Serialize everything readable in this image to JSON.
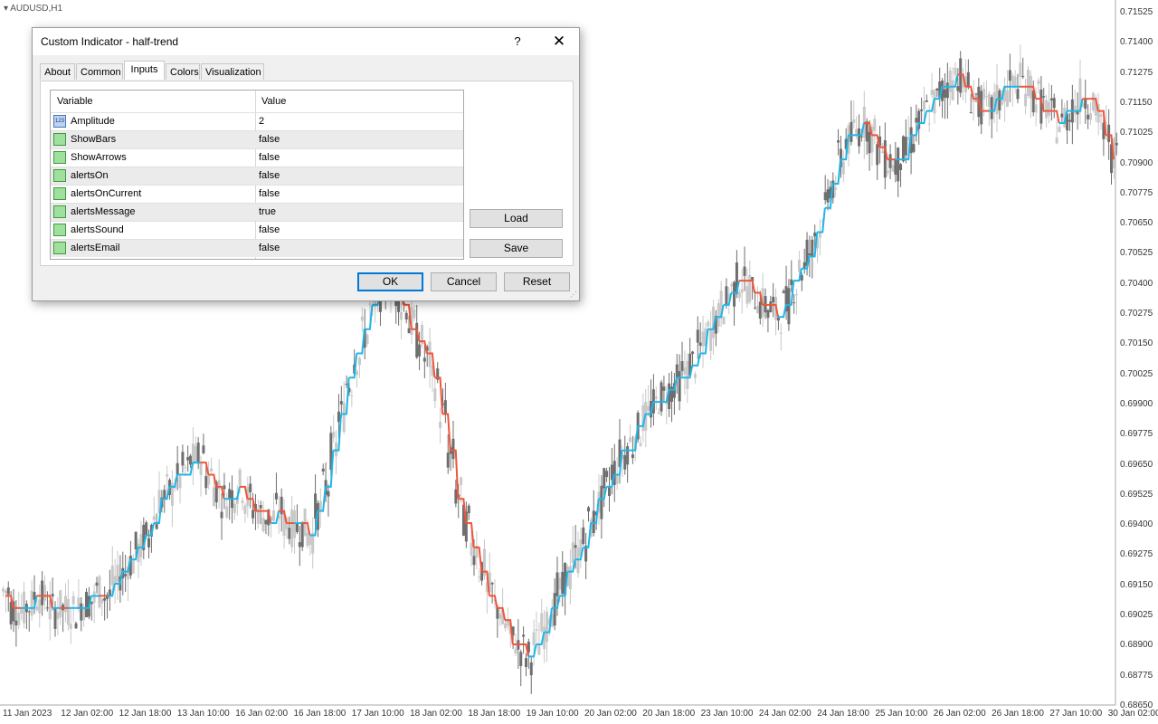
{
  "window": {
    "symbol": "AUDUSD,H1"
  },
  "y_axis": {
    "labels": [
      "0.71525",
      "0.71400",
      "0.71275",
      "0.71150",
      "0.71025",
      "0.70900",
      "0.70775",
      "0.70650",
      "0.70525",
      "0.70400",
      "0.70275",
      "0.70150",
      "0.70025",
      "0.69900",
      "0.69775",
      "0.69650",
      "0.69525",
      "0.69400",
      "0.69275",
      "0.69150",
      "0.69025",
      "0.68900",
      "0.68775",
      "0.68650"
    ]
  },
  "x_axis": {
    "labels": [
      "11 Jan 2023",
      "12 Jan 02:00",
      "12 Jan 18:00",
      "13 Jan 10:00",
      "16 Jan 02:00",
      "16 Jan 18:00",
      "17 Jan 10:00",
      "18 Jan 02:00",
      "18 Jan 18:00",
      "19 Jan 10:00",
      "20 Jan 02:00",
      "20 Jan 18:00",
      "23 Jan 10:00",
      "24 Jan 02:00",
      "24 Jan 18:00",
      "25 Jan 10:00",
      "26 Jan 02:00",
      "26 Jan 18:00",
      "27 Jan 10:00",
      "30 Jan 02:00"
    ]
  },
  "colors": {
    "trend_up": "#1fb6e8",
    "trend_down": "#f0553a",
    "candle_bull": "#c8c8c8",
    "candle_bear": "#6e6e6e",
    "accent": "#0078d7"
  },
  "chart_data": {
    "type": "line",
    "series": [
      {
        "values": [
          0.6912,
          0.6905,
          0.6904,
          0.6906,
          0.691,
          0.6909,
          0.6904,
          0.6905,
          0.6904,
          0.6904,
          0.6907,
          0.6908,
          0.6912,
          0.691,
          0.6915,
          0.6919,
          0.6924,
          0.6929,
          0.6934,
          0.6942,
          0.695,
          0.6953,
          0.6958,
          0.6962,
          0.6966,
          0.6967,
          0.696,
          0.6955,
          0.695,
          0.6952,
          0.6955,
          0.695,
          0.6946,
          0.6943,
          0.6942,
          0.6945,
          0.694,
          0.6938,
          0.6938,
          0.6935,
          0.6945,
          0.6955,
          0.697,
          0.6985,
          0.6998,
          0.7008,
          0.7018,
          0.7028,
          0.7035,
          0.704,
          0.7035,
          0.703,
          0.7022,
          0.7015,
          0.7008,
          0.6998,
          0.6985,
          0.6968,
          0.6952,
          0.694,
          0.693,
          0.6922,
          0.6912,
          0.6905,
          0.6898,
          0.6892,
          0.6888,
          0.6885,
          0.689,
          0.6896,
          0.6905,
          0.6912,
          0.6918,
          0.6926,
          0.6932,
          0.694,
          0.6948,
          0.6955,
          0.6962,
          0.6968,
          0.6972,
          0.6978,
          0.6983,
          0.6988,
          0.6992,
          0.6995,
          0.6998,
          0.7002,
          0.7006,
          0.7012,
          0.7018,
          0.7024,
          0.703,
          0.7036,
          0.704,
          0.7038,
          0.7034,
          0.703,
          0.7028,
          0.7026,
          0.703,
          0.7038,
          0.7045,
          0.7052,
          0.706,
          0.707,
          0.708,
          0.709,
          0.7098,
          0.7102,
          0.7105,
          0.71,
          0.7094,
          0.709,
          0.7088,
          0.7092,
          0.7098,
          0.7104,
          0.711,
          0.7114,
          0.7118,
          0.7122,
          0.7125,
          0.712,
          0.7116,
          0.7112,
          0.711,
          0.7114,
          0.7118,
          0.712,
          0.7122,
          0.712,
          0.7116,
          0.7112,
          0.7108,
          0.7104,
          0.7108,
          0.7112,
          0.7116,
          0.7114,
          0.7108,
          0.71,
          0.7092
        ]
      }
    ],
    "ylim": [
      0.6865,
      0.7155
    ]
  },
  "dialog": {
    "title": "Custom Indicator - half-trend",
    "help": "?",
    "close": "✕",
    "tabs": [
      "About",
      "Common",
      "Inputs",
      "Colors",
      "Visualization"
    ],
    "active_tab": "Inputs",
    "grid": {
      "headers": [
        "Variable",
        "Value"
      ],
      "rows": [
        {
          "name": "Amplitude",
          "value": "2",
          "icon": "number-icon",
          "icon_text": "123"
        },
        {
          "name": "ShowBars",
          "value": "false",
          "icon": "boolean-icon"
        },
        {
          "name": "ShowArrows",
          "value": "false",
          "icon": "boolean-icon"
        },
        {
          "name": "alertsOn",
          "value": "false",
          "icon": "boolean-icon"
        },
        {
          "name": "alertsOnCurrent",
          "value": "false",
          "icon": "boolean-icon"
        },
        {
          "name": "alertsMessage",
          "value": "true",
          "icon": "boolean-icon"
        },
        {
          "name": "alertsSound",
          "value": "false",
          "icon": "boolean-icon"
        },
        {
          "name": "alertsEmail",
          "value": "false",
          "icon": "boolean-icon"
        }
      ]
    },
    "buttons": {
      "load": "Load",
      "save": "Save",
      "ok": "OK",
      "cancel": "Cancel",
      "reset": "Reset"
    }
  }
}
